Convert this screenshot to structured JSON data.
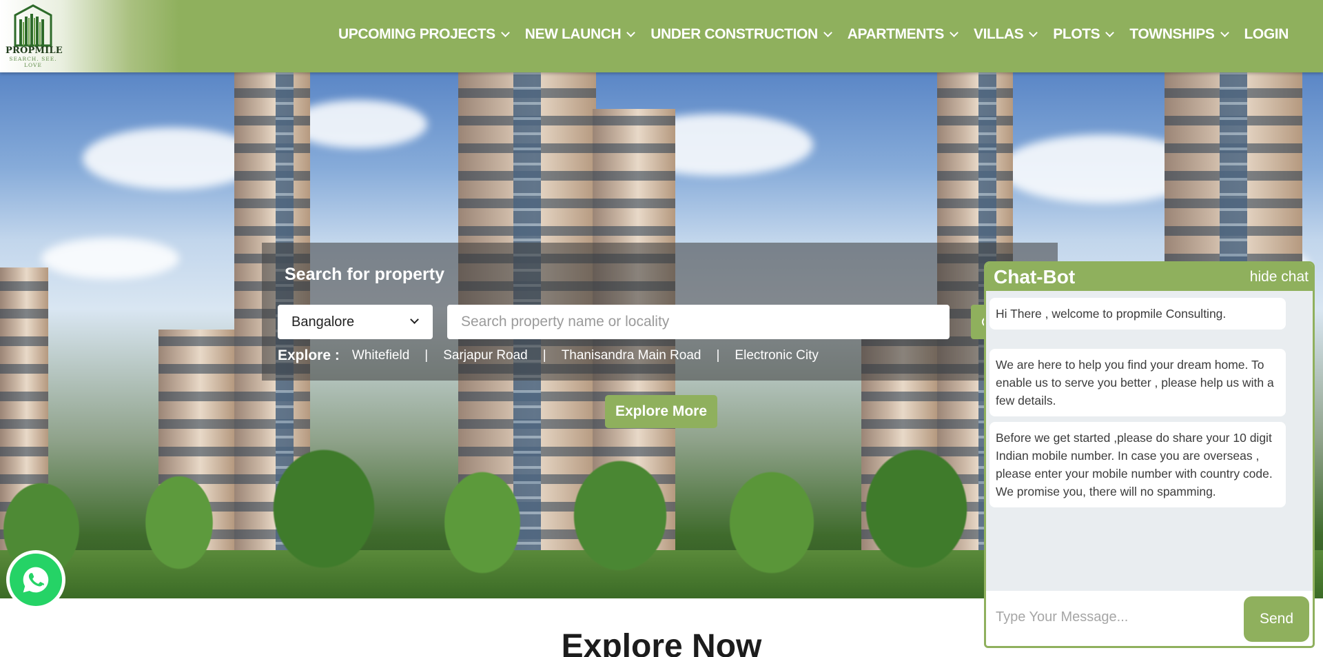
{
  "brand": {
    "name": "PROPMILE",
    "tagline": "SEARCH. SEE. LOVE",
    "accent_color": "#8fb05d"
  },
  "nav": {
    "items": [
      {
        "label": "UPCOMING PROJECTS",
        "dropdown": true
      },
      {
        "label": "NEW LAUNCH",
        "dropdown": true
      },
      {
        "label": "UNDER CONSTRUCTION",
        "dropdown": true
      },
      {
        "label": "APARTMENTS",
        "dropdown": true
      },
      {
        "label": "VILLAS",
        "dropdown": true
      },
      {
        "label": "PLOTS",
        "dropdown": true
      },
      {
        "label": "TOWNSHIPS",
        "dropdown": true
      },
      {
        "label": "LOGIN",
        "dropdown": false
      }
    ]
  },
  "search": {
    "title": "Search for property",
    "city_selected": "Bangalore",
    "placeholder": "Search property name or locality",
    "explore_label": "Explore :",
    "explore_links": [
      "Whitefield",
      "Sarjapur Road",
      "Thanisandra Main Road",
      "Electronic City"
    ],
    "separator": "|"
  },
  "hero": {
    "explore_more_label": "Explore More"
  },
  "section": {
    "heading": "Explore Now"
  },
  "chatbot": {
    "title": "Chat-Bot",
    "hide_label": "hide chat",
    "messages": [
      "Hi There , welcome to propmile Consulting.",
      "We are here to help you find your dream home. To enable us to serve you better , please help us with a few details.",
      "Before we get started ,please do share your 10 digit Indian mobile number. In case you are overseas , please enter your mobile number with country code. We promise you, there will no spamming."
    ],
    "input_placeholder": "Type Your Message...",
    "send_label": "Send"
  }
}
